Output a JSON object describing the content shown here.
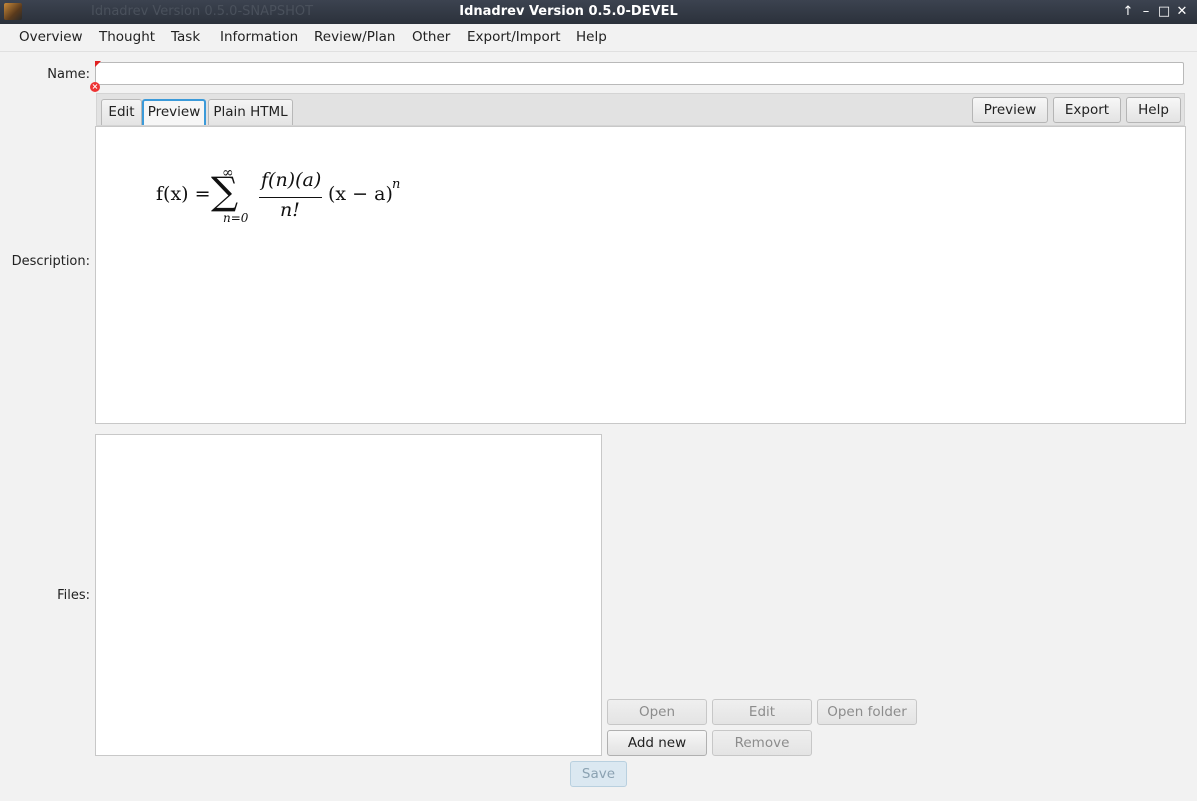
{
  "window": {
    "ghost_title": "Idnadrev Version 0.5.0-SNAPSHOT",
    "title": "Idnadrev Version 0.5.0-DEVEL",
    "controls": [
      "↑",
      "–",
      "□",
      "✕"
    ]
  },
  "menu": {
    "items": [
      "Overview",
      "Thought",
      "Task",
      "Information",
      "Review/Plan",
      "Other",
      "Export/Import",
      "Help"
    ]
  },
  "form": {
    "name_label": "Name:",
    "name_value": "",
    "description_label": "Description:",
    "files_label": "Files:"
  },
  "editor": {
    "tabs": [
      "Edit",
      "Preview",
      "Plain HTML"
    ],
    "selected_tab": "Preview",
    "actions": [
      "Preview",
      "Export",
      "Help"
    ]
  },
  "preview_formula": {
    "lhs": "f(x) =",
    "sum_top": "∞",
    "sum_symbol": "∑",
    "sum_bottom": "n=0",
    "numerator": "f(n)(a)",
    "denominator": "n!",
    "tail": "(x − a)",
    "exponent": "n"
  },
  "files": {
    "items": [],
    "buttons_row1": [
      "Open",
      "Edit",
      "Open folder"
    ],
    "buttons_row2": [
      "Add new",
      "Remove"
    ],
    "enabled": [
      "Add new"
    ]
  },
  "save_label": "Save"
}
